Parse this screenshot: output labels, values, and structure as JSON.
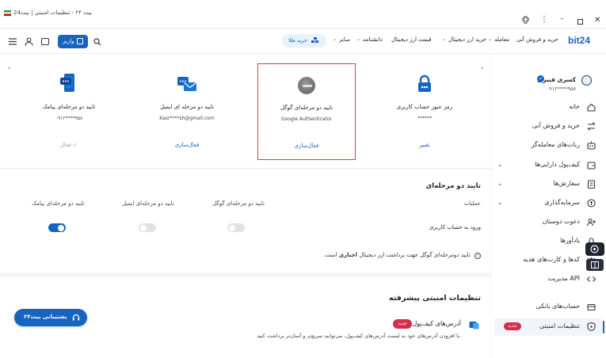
{
  "titlebar": {
    "tab_title": "بیت ۲۴ - تنظیمات امنیتی | بیت24"
  },
  "navbar": {
    "logo": "bit24",
    "menu": [
      {
        "label": "خرید و فروش آنی"
      },
      {
        "label": "معامله"
      },
      {
        "label": "خرید ارز دیجیتال"
      },
      {
        "label": "قیمت ارز دیجیتال"
      },
      {
        "label": "دانشنامه"
      },
      {
        "label": "سایر"
      }
    ],
    "gold_button": "خرید طلا",
    "deposit_button": "واریز"
  },
  "sidebar": {
    "user_name": "کسری قنبری",
    "user_phone": "۰۹۱۲****۹۵۸",
    "items": [
      {
        "label": "خانه",
        "icon": "home-icon",
        "chevron": false
      },
      {
        "label": "خرید و فروش آنی",
        "icon": "swap-icon",
        "chevron": false
      },
      {
        "label": "ربات‌های معامله‌گر",
        "icon": "robot-icon",
        "chevron": false
      },
      {
        "label": "کیف‌پول دارایی‌ها",
        "icon": "wallet-icon",
        "chevron": true
      },
      {
        "label": "سفارش‌ها",
        "icon": "orders-icon",
        "chevron": true
      },
      {
        "label": "سرمایه‌گذاری",
        "icon": "investment-icon",
        "chevron": true
      },
      {
        "label": "دعوت دوستان",
        "icon": "invite-icon",
        "chevron": false
      },
      {
        "label": "یادآورها",
        "icon": "bell-icon",
        "chevron": false
      },
      {
        "label": "کدها و کارت‌های هدیه",
        "icon": "gift-icon",
        "chevron": false
      },
      {
        "label": "مدیریت API",
        "icon": "code-icon",
        "chevron": false
      },
      {
        "label": "حساب‌های بانکی",
        "icon": "bank-icon",
        "chevron": false
      },
      {
        "label": "تنظیمات امنیتی",
        "icon": "shield-icon",
        "chevron": false,
        "badge": "جدید"
      }
    ]
  },
  "cards": [
    {
      "title": "رمز عبور حساب کاربری",
      "sub": "******",
      "action": "تغییر"
    },
    {
      "title": "تایید دو مرحله‌ای گوگل",
      "sub": "Google Authenticator",
      "action": "فعال‌سازی"
    },
    {
      "title": "تایید دو مرحله ای ایمیل",
      "sub": "Kasr****sh@gmail.com",
      "action": "فعال‌سازی"
    },
    {
      "title": "تایید دو مرحله‌ای پیامک",
      "sub": "۰۹۱۲****۹۵۸",
      "action": "فعال"
    }
  ],
  "twofa": {
    "section_title": "تایید دو مرحله‌ای",
    "col_operations": "عملیات",
    "col_google": "تایید دو مرحله‌ای گوگل",
    "col_email": "تایید دو مرحله‌ای ایمیل",
    "col_sms": "تایید دو مرحله‌ای پیامک",
    "row_label": "ورود به حساب کاربری",
    "note_prefix": "تایید دومرحله‌ای گوگل جهت برداشت ارز دیجیتال",
    "note_bold": "اجباری",
    "note_suffix": "است.",
    "toggles": {
      "google": false,
      "email": false,
      "sms": true
    }
  },
  "advanced": {
    "title": "تنظیمات امنیتی پیشرفته",
    "item_title": "آدرس‌های کیف‌پول",
    "item_badge": "جدید",
    "item_desc": "با افزودن آدرس‌های خود به لیست آدرس‌های کیف‌پول، می‌توانید سریع‌تر و آسان‌تر برداشت کنید."
  },
  "support_button": "پشتیبانی بیت۲۴",
  "colors": {
    "accent": "#1565c0",
    "badge": "#d32f4a",
    "highlight": "#e53935"
  }
}
